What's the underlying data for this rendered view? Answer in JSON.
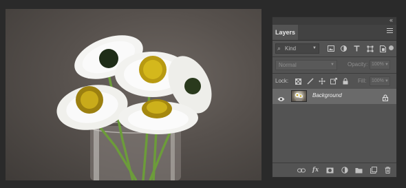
{
  "panel": {
    "collapse_glyph": "‹‹",
    "tab_label": "Layers",
    "menu_icon": "hamburger-menu-icon"
  },
  "filter": {
    "kind_label": "Kind",
    "icons": [
      "pixel-layer-filter-icon",
      "adjustment-layer-filter-icon",
      "type-layer-filter-icon",
      "shape-layer-filter-icon",
      "smart-object-filter-icon"
    ]
  },
  "blend": {
    "mode": "Normal",
    "opacity_label": "Opacity:",
    "opacity_value": "100%"
  },
  "lock": {
    "label": "Lock:",
    "icons": [
      "lock-transparent-pixels-icon",
      "lock-image-pixels-icon",
      "lock-position-icon",
      "prevent-autonest-icon",
      "lock-all-icon"
    ],
    "fill_label": "Fill:",
    "fill_value": "100%"
  },
  "layers": [
    {
      "name": "Background",
      "visible": true,
      "locked": true
    }
  ],
  "bottom_icons": [
    "link-layers-icon",
    "fx-icon",
    "layer-mask-icon",
    "adjustment-layer-icon",
    "new-group-icon",
    "new-layer-icon",
    "delete-layer-icon"
  ],
  "bottom_fx_label": "fx",
  "colors": {
    "panel_bg": "#535353",
    "selected_row": "#6a6a6a",
    "app_bg": "#2a2a2a"
  }
}
